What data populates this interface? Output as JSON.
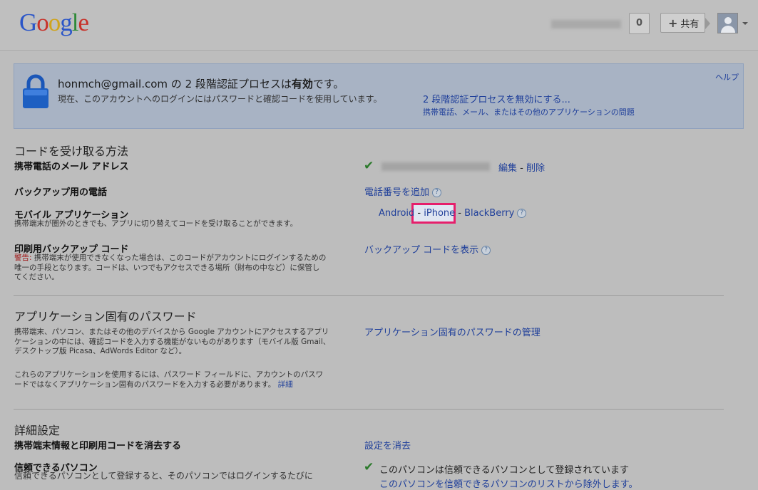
{
  "header": {
    "logo": [
      "G",
      "o",
      "o",
      "g",
      "l",
      "e"
    ],
    "notification_count": "0",
    "share_label": "共有",
    "share_plus": "+"
  },
  "status": {
    "email": "honmch@gmail.com",
    "title_mid": " の 2 段階認証プロセスは",
    "title_bold": "有効",
    "title_end": "です。",
    "subtitle": "現在、このアカウントへのログインにはパスワードと確認コードを使用しています。",
    "disable_link": "2 段階認証プロセスを無効にする...",
    "problem_link": "携帯電話、メール、またはその他のアプリケーションの問題",
    "help_link": "ヘルプ"
  },
  "receive": {
    "section_title": "コードを受け取る方法",
    "mobile_email_label": "携帯電話のメール アドレス",
    "edit_link": "編集",
    "dash": "-",
    "delete_link": "削除",
    "backup_phone_label": "バックアップ用の電話",
    "add_phone_link": "電話番号を追加",
    "mobile_app_label": "モバイル アプリケーション",
    "mobile_app_desc": "携帯端末が圏外のときでも、アプリに切り替えてコードを受け取ることができます。",
    "app_android": "Android",
    "app_iphone": "iPhone",
    "app_blackberry": "BlackBerry",
    "printed_label": "印刷用バックアップ コード",
    "warning_prefix": "警告:",
    "printed_desc_1": " 携帯端末が使用できなくなった場合は、このコードがアカウントにログインするための",
    "printed_desc_2": "唯一の手段となります。コードは、いつでもアクセスできる場所（財布の中など）に保管し",
    "printed_desc_3": "てください。",
    "show_codes_link": "バックアップ コードを表示"
  },
  "app_passwords": {
    "section_title": "アプリケーション固有のパスワード",
    "desc_1": "携帯端末、パソコン、またはその他のデバイスから Google アカウントにアクセスするアプリ",
    "desc_2": "ケーションの中には、確認コードを入力する機能がないものがあります（モバイル版 Gmail、",
    "desc_3": "デスクトップ版 Picasa、AdWords Editor など）。",
    "desc_4": "これらのアプリケーションを使用するには、パスワード フィールドに、アカウントのパスワ",
    "desc_5": "ードではなくアプリケーション固有のパスワードを入力する必要があります。",
    "details_link": "詳細",
    "manage_link": "アプリケーション固有のパスワードの管理"
  },
  "advanced": {
    "section_title": "詳細設定",
    "clear_label": "携帯端末情報と印刷用コードを消去する",
    "clear_link": "設定を消去",
    "trusted_label": "信頼できるパソコン",
    "trusted_desc": "信頼できるパソコンとして登録すると、そのパソコンではログインするたびに",
    "trusted_status": "このパソコンは信頼できるパソコンとして登録されています",
    "trusted_remove_link": "このパソコンを信頼できるパソコンのリストから除外します。"
  },
  "colors": {
    "link": "#1f3f9a",
    "highlight_border": "#e61f6b",
    "check": "#2b7a2b",
    "status_bg": "#a8b3c4"
  },
  "icons": [
    "lock-icon",
    "help-icon",
    "check-icon",
    "plus-icon",
    "avatar-icon",
    "caret-down-icon"
  ]
}
